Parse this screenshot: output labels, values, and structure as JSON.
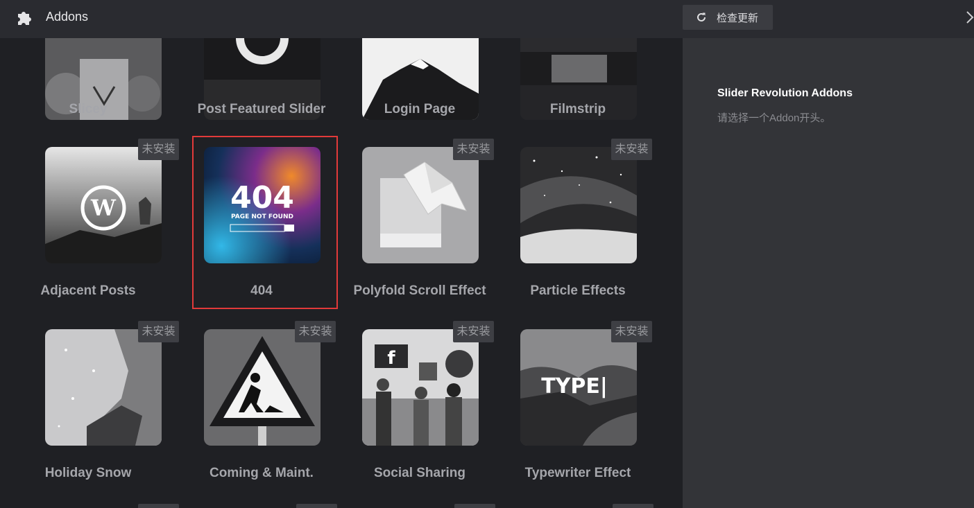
{
  "header": {
    "title": "Addons",
    "puzzle_icon": "puzzle-icon",
    "check_updates_label": "检查更新",
    "refresh_icon": "refresh-icon",
    "close_icon": "chevron-right-icon"
  },
  "sidebar": {
    "title": "Slider Revolution Addons",
    "subtitle": "请选择一个Addon开头。"
  },
  "addons": [
    {
      "title": "Slicey",
      "badge": ""
    },
    {
      "title": "Post Featured Slider",
      "badge": ""
    },
    {
      "title": "Login Page",
      "badge": ""
    },
    {
      "title": "Filmstrip",
      "badge": ""
    },
    {
      "title": "Adjacent Posts",
      "badge": "未安装"
    },
    {
      "title": "404",
      "badge": "",
      "thumb_text": "404",
      "thumb_subtext": "PAGE NOT FOUND",
      "selected": true
    },
    {
      "title": "Polyfold Scroll Effect",
      "badge": "未安装"
    },
    {
      "title": "Particle Effects",
      "badge": "未安装"
    },
    {
      "title": "Holiday Snow",
      "badge": "未安装"
    },
    {
      "title": "Coming & Maint.",
      "badge": "未安装"
    },
    {
      "title": "Social Sharing",
      "badge": "未安装"
    },
    {
      "title": "Typewriter Effect",
      "badge": "未安装",
      "thumb_text": "TYPE|"
    }
  ],
  "colors": {
    "background": "#1f2024",
    "header": "#2a2b30",
    "sidebar": "#333438",
    "selection_border": "#e23a3a",
    "badge_bg": "#3e3f44"
  }
}
